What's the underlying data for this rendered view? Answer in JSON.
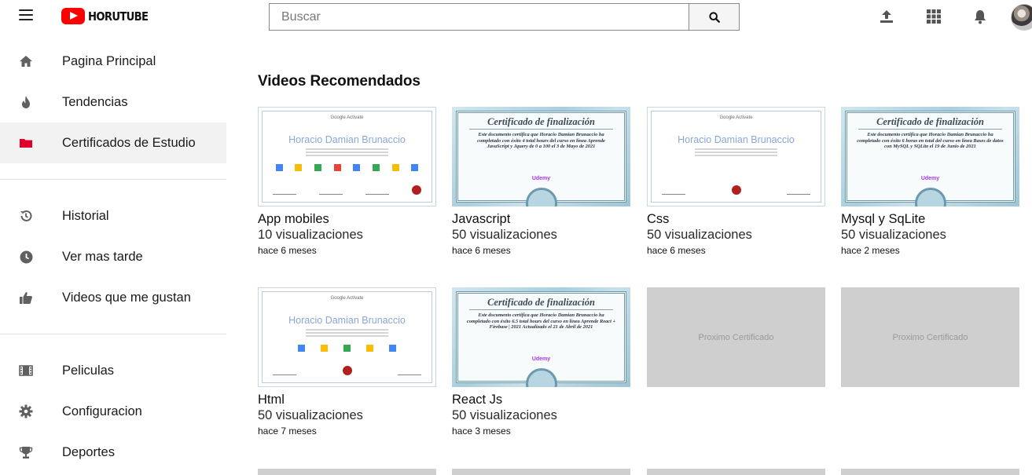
{
  "header": {
    "logo_text": "HORUTUBE",
    "search_placeholder": "Buscar"
  },
  "sidebar": {
    "groups": [
      [
        {
          "label": "Pagina Principal",
          "icon": "home-icon"
        },
        {
          "label": "Tendencias",
          "icon": "fire-icon"
        },
        {
          "label": "Certificados de Estudio",
          "icon": "folder-icon",
          "active": true
        }
      ],
      [
        {
          "label": "Historial",
          "icon": "history-icon"
        },
        {
          "label": "Ver mas tarde",
          "icon": "clock-icon"
        },
        {
          "label": "Videos que me gustan",
          "icon": "thumbs-up-icon"
        }
      ],
      [
        {
          "label": "Peliculas",
          "icon": "film-icon"
        },
        {
          "label": "Configuracion",
          "icon": "gear-icon"
        },
        {
          "label": "Deportes",
          "icon": "trophy-icon"
        }
      ]
    ]
  },
  "main": {
    "section_title": "Videos Recomendados",
    "cards": [
      {
        "title": "App mobiles",
        "views": "10 visualizaciones",
        "ago": "hace 6 meses",
        "thumb": "google",
        "cert": {
          "head": "Google Activate",
          "name": "Horacio Damian Brunaccio"
        }
      },
      {
        "title": "Javascript",
        "views": "50 visualizaciones",
        "ago": "hace 6 meses",
        "thumb": "udemy",
        "cert": {
          "head": "Certificado de finalización",
          "body": "Este documento certifica que Horacio Damian Brunaccio ha completado con éxito 4 total hours del curso en línea Aprende JavaScript y Jquery de 0 a 100 el 3 de Mayo de 2021",
          "logo": "Udemy"
        }
      },
      {
        "title": "Css",
        "views": "50 visualizaciones",
        "ago": "hace 6 meses",
        "thumb": "google",
        "cert": {
          "head": "Google Activate",
          "name": "Horacio Damian Brunaccio"
        }
      },
      {
        "title": "Mysql y SqLite",
        "views": "50 visualizaciones",
        "ago": "hace 2 meses",
        "thumb": "udemy",
        "cert": {
          "head": "Certificado de finalización",
          "body": "Este documento certifica que Horacio Damian Brunaccio ha completado con éxito 6 horas en total del curso en línea Bases de datos con MySQL y SQLite el 19 de Junio de 2021",
          "logo": "Udemy"
        }
      },
      {
        "title": "Html",
        "views": "50 visualizaciones",
        "ago": "hace 7 meses",
        "thumb": "google",
        "cert": {
          "head": "Google Activate",
          "name": "Horacio Damian Brunaccio"
        }
      },
      {
        "title": "React Js",
        "views": "50 visualizaciones",
        "ago": "hace 3 meses",
        "thumb": "udemy",
        "cert": {
          "head": "Certificado de finalización",
          "body": "Este documento certifica que Horacio Damian Brunaccio ha completado con éxito 6.5 total hours del curso en línea Aprende React + Firebase | 2021 Actualizado el 21 de Abril de 2021",
          "logo": "Udemy"
        }
      },
      {
        "placeholder": "Proximo Certificado"
      },
      {
        "placeholder": "Proximo Certificado"
      }
    ]
  },
  "colors": {
    "brand_red": "#ff0000",
    "sidebar_active_icon": "#e1002d",
    "placeholder_gray": "#cfcfcf"
  }
}
